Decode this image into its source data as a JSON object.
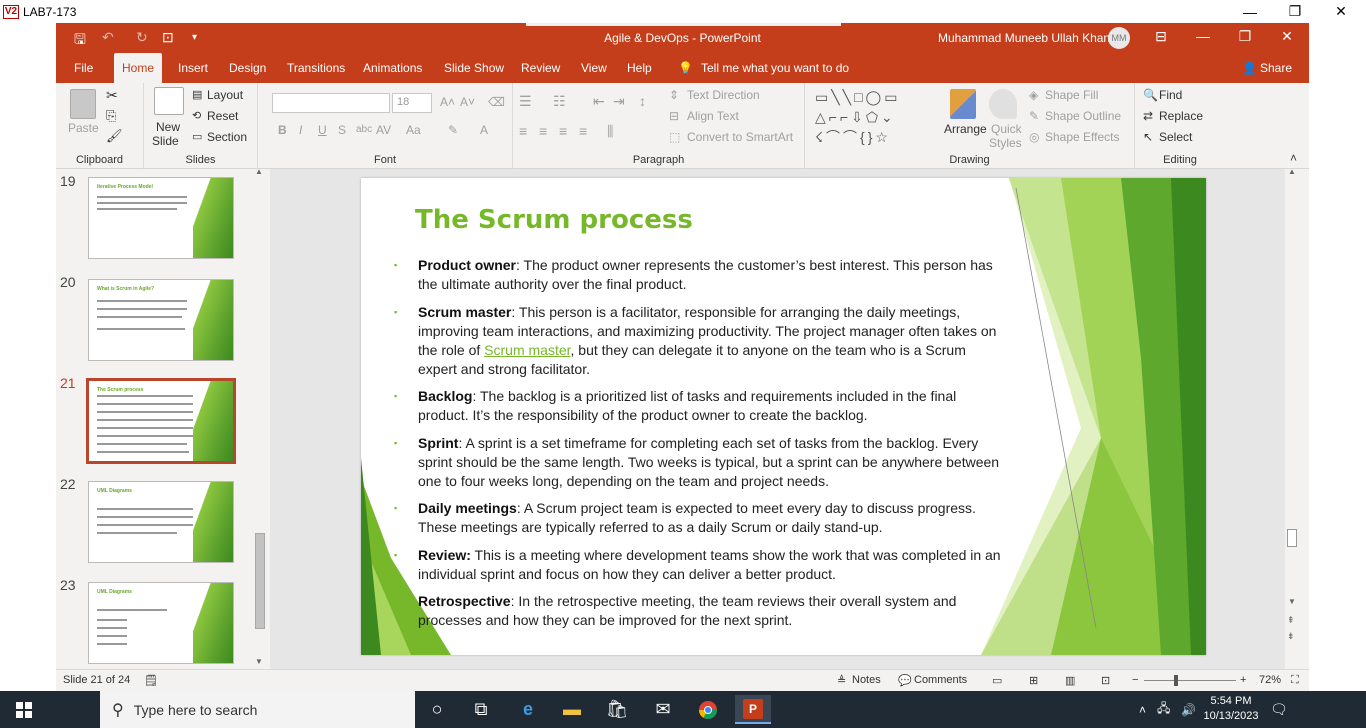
{
  "outer_window": {
    "title": "LAB7-173",
    "logo": "V2"
  },
  "app": {
    "doc_title": "Agile & DevOps  -  PowerPoint",
    "user_name": "Muhammad Muneeb Ullah Khan",
    "user_initials": "MM"
  },
  "menu": {
    "tabs": [
      "File",
      "Home",
      "Insert",
      "Design",
      "Transitions",
      "Animations",
      "Slide Show",
      "Review",
      "View",
      "Help"
    ],
    "active": "Home",
    "tell_me": "Tell me what you want to do",
    "share": "Share"
  },
  "ribbon": {
    "clipboard": {
      "label": "Clipboard",
      "paste": "Paste"
    },
    "slides": {
      "label": "Slides",
      "new_slide": "New",
      "new_slide2": "Slide",
      "layout": "Layout",
      "reset": "Reset",
      "section": "Section"
    },
    "font": {
      "label": "Font",
      "size": "18"
    },
    "paragraph": {
      "label": "Paragraph",
      "text_direction": "Text Direction",
      "align_text": "Align Text",
      "convert_smartart": "Convert to SmartArt"
    },
    "drawing": {
      "label": "Drawing",
      "arrange": "Arrange",
      "quick_styles": "Quick",
      "quick_styles2": "Styles",
      "shape_fill": "Shape Fill",
      "shape_outline": "Shape Outline",
      "shape_effects": "Shape Effects"
    },
    "editing": {
      "label": "Editing",
      "find": "Find",
      "replace": "Replace",
      "select": "Select"
    }
  },
  "thumbnails": [
    {
      "num": "19",
      "title": "Iterative Process Model",
      "active": false
    },
    {
      "num": "20",
      "title": "What is Scrum in Agile?",
      "active": false
    },
    {
      "num": "21",
      "title": "The Scrum process",
      "active": true
    },
    {
      "num": "22",
      "title": "UML Diagrams",
      "active": false
    },
    {
      "num": "23",
      "title": "UML Diagrams",
      "active": false
    }
  ],
  "slide": {
    "title": "The Scrum process",
    "bullets": [
      {
        "term": "Product owner",
        "text": ": The product owner represents the customer’s best interest. This person has the ultimate authority over the final product."
      },
      {
        "term": "Scrum master",
        "text_before": ": This person is a facilitator, responsible for arranging the daily meetings, improving team interactions, and maximizing productivity. The project manager often takes on the role of ",
        "link": "Scrum master",
        "text_after": ", but they can delegate it to anyone on the team who is a Scrum expert and strong facilitator."
      },
      {
        "term": "Backlog",
        "text": ": The backlog is a prioritized list of tasks and requirements included in the final product. It’s the responsibility of the product owner to create the backlog."
      },
      {
        "term": "Sprint",
        "text": ": A sprint is a set timeframe for completing each set of tasks from the backlog. Every sprint should be the same length. Two weeks is typical, but a sprint can be anywhere between one to four weeks long, depending on the team and project needs."
      },
      {
        "term": "Daily meetings",
        "text": ": A Scrum project team is expected to meet every day to discuss progress. These meetings are typically referred to as a daily Scrum or daily stand-up."
      },
      {
        "term": "Review:",
        "text": " This is a meeting where development teams show the work that was completed in an individual sprint and focus on how they can deliver a better product."
      },
      {
        "term": "Retrospective",
        "text": ": In the retrospective meeting, the team reviews their overall system and processes and how they can be improved for the next sprint."
      }
    ]
  },
  "status": {
    "slide_count": "Slide 21 of 24",
    "notes": "Notes",
    "comments": "Comments",
    "zoom": "72%"
  },
  "taskbar": {
    "search_placeholder": "Type here to search",
    "time": "5:54 PM",
    "date": "10/13/2023"
  },
  "colors": {
    "accent": "#c43e1c",
    "slide_green": "#76b82a"
  }
}
